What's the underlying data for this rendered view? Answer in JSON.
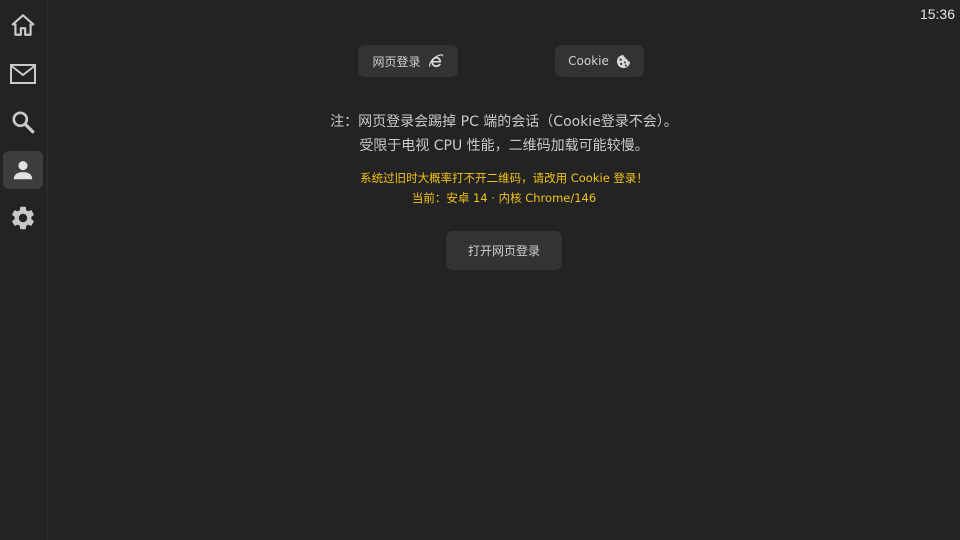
{
  "status_bar": {
    "time": "15:36"
  },
  "sidebar": {
    "items": [
      {
        "name": "home",
        "icon": "home-icon",
        "active": false
      },
      {
        "name": "messages",
        "icon": "mail-icon",
        "active": false
      },
      {
        "name": "search",
        "icon": "search-icon",
        "active": false
      },
      {
        "name": "account",
        "icon": "person-icon",
        "active": true
      },
      {
        "name": "settings",
        "icon": "gear-icon",
        "active": false
      }
    ]
  },
  "login_tabs": {
    "web_login_label": "网页登录",
    "web_login_icon": "internet-explorer-icon",
    "cookie_label": "Cookie",
    "cookie_icon": "cookie-icon"
  },
  "notes": {
    "line1": "注：网页登录会踢掉 PC 端的会话（Cookie登录不会）。",
    "line2": "受限于电视 CPU 性能，二维码加载可能较慢。"
  },
  "warning": {
    "line1": "系统过旧时大概率打不开二维码，请改用 Cookie 登录！",
    "line2": "当前：安卓 14 · 内核 Chrome/146",
    "color": "#f2c318"
  },
  "actions": {
    "open_web_login_label": "打开网页登录"
  },
  "colors": {
    "background": "#232323",
    "button_bg": "#333333",
    "sidebar_active": "#3d3d3d"
  }
}
